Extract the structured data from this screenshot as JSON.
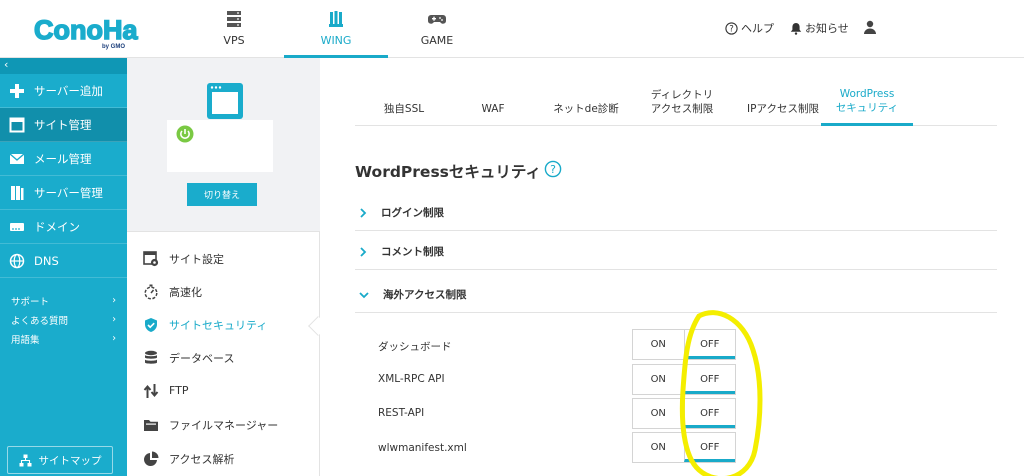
{
  "header": {
    "logo_text": "ConoHa",
    "logo_sub": "by GMO",
    "tabs": [
      {
        "label": "VPS",
        "icon": "server-icon"
      },
      {
        "label": "WING",
        "icon": "wing-icon",
        "active": true
      },
      {
        "label": "GAME",
        "icon": "gamepad-icon"
      }
    ],
    "help_label": "ヘルプ",
    "notice_label": "お知らせ",
    "user_icon": "user-icon"
  },
  "sidebar": {
    "collapse_label": "‹",
    "items": [
      {
        "label": "サーバー追加",
        "icon": "plus-icon"
      },
      {
        "label": "サイト管理",
        "icon": "window-icon",
        "active": true
      },
      {
        "label": "メール管理",
        "icon": "mail-icon"
      },
      {
        "label": "サーバー管理",
        "icon": "server-icon"
      },
      {
        "label": "ドメイン",
        "icon": "domain-icon"
      },
      {
        "label": "DNS",
        "icon": "globe-icon"
      }
    ],
    "links": [
      {
        "label": "サポート",
        "arrow": "›"
      },
      {
        "label": "よくある質問",
        "arrow": "›"
      },
      {
        "label": "用語集",
        "arrow": "›"
      }
    ],
    "sitemap_label": "サイトマップ"
  },
  "subnav": {
    "switch_label": "切り替え",
    "items": [
      {
        "label": "サイト設定",
        "icon": "site-settings-icon"
      },
      {
        "label": "高速化",
        "icon": "stopwatch-icon"
      },
      {
        "label": "サイトセキュリティ",
        "icon": "shield-check-icon",
        "active": true
      },
      {
        "label": "データベース",
        "icon": "database-icon"
      },
      {
        "label": "FTP",
        "icon": "transfer-icon"
      },
      {
        "label": "ファイルマネージャー",
        "icon": "folder-icon"
      },
      {
        "label": "アクセス解析",
        "icon": "pie-chart-icon"
      }
    ]
  },
  "main": {
    "tabs": [
      {
        "label": "独自SSL"
      },
      {
        "label": "WAF"
      },
      {
        "label": "ネットde診断"
      },
      {
        "label": "ディレクトリ\nアクセス制限"
      },
      {
        "label": "IPアクセス制限"
      },
      {
        "label": "WordPress\nセキュリティ",
        "active": true
      }
    ],
    "title": "WordPressセキュリティ",
    "accordions": [
      {
        "label": "ログイン制限",
        "open": false
      },
      {
        "label": "コメント制限",
        "open": false
      },
      {
        "label": "海外アクセス制限",
        "open": true
      }
    ],
    "settings": [
      {
        "label": "ダッシュボード",
        "on": "ON",
        "off": "OFF",
        "value": "OFF"
      },
      {
        "label": "XML-RPC API",
        "on": "ON",
        "off": "OFF",
        "value": "OFF"
      },
      {
        "label": "REST-API",
        "on": "ON",
        "off": "OFF",
        "value": "OFF"
      },
      {
        "label": "wlwmanifest.xml",
        "on": "ON",
        "off": "OFF",
        "value": "OFF"
      }
    ]
  },
  "colors": {
    "accent": "#1aaccc",
    "sidebar_active": "#118fab",
    "highlight": "#f4ee00",
    "power_green": "#7ac943"
  }
}
